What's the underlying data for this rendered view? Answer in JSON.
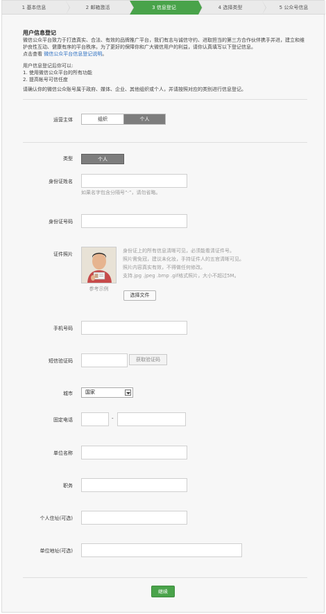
{
  "steps": [
    {
      "label": "1 基本信息",
      "active": false
    },
    {
      "label": "2 邮箱激活",
      "active": false
    },
    {
      "label": "3 信息登记",
      "active": true
    },
    {
      "label": "4 选择类型",
      "active": false
    },
    {
      "label": "5 公众号信息",
      "active": false
    }
  ],
  "header": {
    "title": "用户信息登记",
    "intro": "微信公众平台致力于打造真实、合法、有效的品牌推广平台，我们有志与诚信守约、进取担当的第三方合作伙伴携手并进，建立和维护良性互动、健康有序的平台秩序。为了更好的保障你和广大微信用户的利益，请你认真填写以下登记信息。",
    "intro_link_prefix": "点击查看",
    "intro_link": "微信公众平台信息登记说明",
    "intro_link_suffix": "。",
    "after_title": "用户信息登记后你可以:",
    "after_items": [
      "1. 使用微信公众平台的所有功能",
      "2. 提高帐号可信任度"
    ],
    "choose_note": "请确认你的微信公众账号属于政府、媒体、企业、其他组织或个人，并请按照对应的类别进行信息登记。"
  },
  "form": {
    "operator_label": "运营主体",
    "operator_options": [
      "组织",
      "个人"
    ],
    "operator_selected": "个人",
    "type_label": "类型",
    "type_value": "个人",
    "id_name_label": "身份证姓名",
    "id_name_value": "",
    "id_name_hint": "如果名字包含分隔号“·”，请勿省略。",
    "id_number_label": "身份证号码",
    "id_number_value": "",
    "id_photo_label": "证件照片",
    "photo_caption": "参考示例",
    "photo_notes": [
      "身份证上的所有信息清晰可见，必须能看清证件号。",
      "照片需免冠，建议未化妆，手持证件人的五官清晰可见。",
      "照片内容真实有效，不得做任何修改。",
      "支持.jpg .jpeg .bmp .gif格式照片，大小不超过5M。"
    ],
    "choose_file_label": "选择文件",
    "phone_label": "手机号码",
    "phone_value": "",
    "sms_label": "短信验证码",
    "sms_value": "",
    "get_code_label": "获取验证码",
    "city_label": "城市",
    "city_value": "国家",
    "landline_label": "固定电话",
    "landline_separator": "-",
    "company_label": "单位名称",
    "position_label": "职务",
    "home_address_label": "个人住址(可选)",
    "company_address_label": "单位地址(可选)"
  },
  "submit_label": "继续",
  "colors": {
    "accent": "#49a34a",
    "link": "#2a6ec2",
    "selected_segment": "#7d7d7d"
  }
}
